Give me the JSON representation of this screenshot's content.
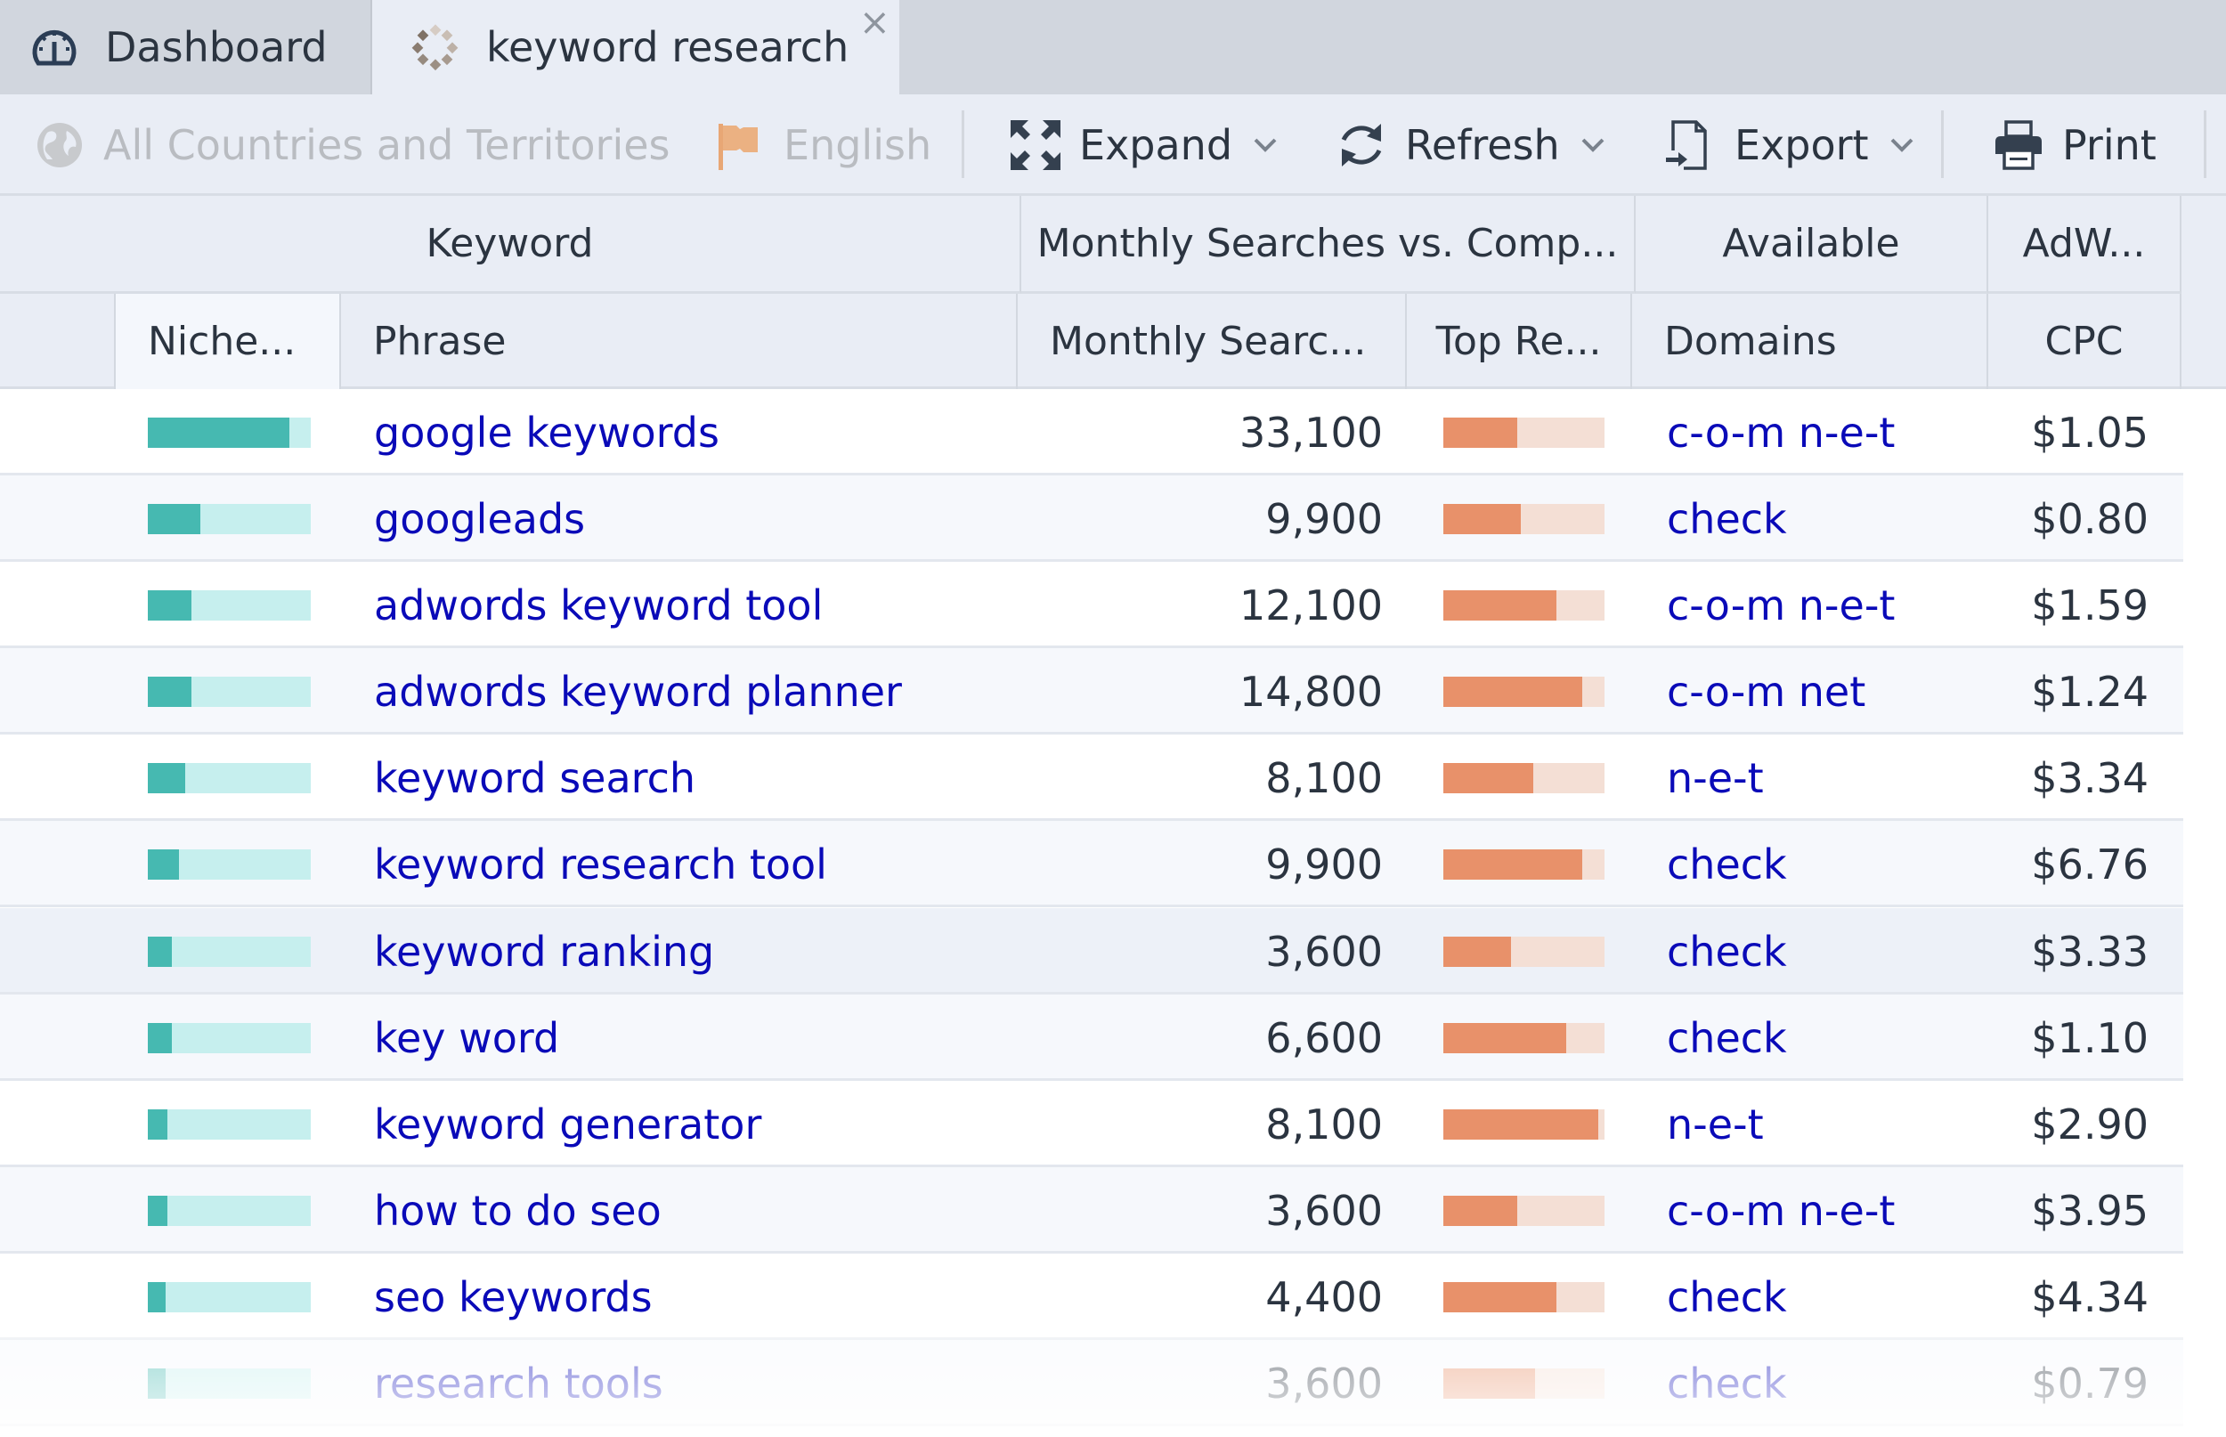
{
  "tabs": [
    {
      "label": "Dashboard",
      "icon": "dashboard-gauge-icon",
      "active": false
    },
    {
      "label": "keyword research",
      "icon": "loading-spinner-icon",
      "active": true,
      "closable": true,
      "close_glyph": "×"
    }
  ],
  "toolbar": {
    "location": {
      "label": "All Countries and Territories",
      "icon": "globe-icon",
      "disabled": true
    },
    "language": {
      "label": "English",
      "icon": "flag-icon",
      "disabled": true
    },
    "expand": {
      "label": "Expand",
      "icon": "expand-arrows-icon",
      "has_dropdown": true
    },
    "refresh": {
      "label": "Refresh",
      "icon": "refresh-icon",
      "has_dropdown": true
    },
    "export": {
      "label": "Export",
      "icon": "export-file-icon",
      "has_dropdown": true
    },
    "print": {
      "label": "Print",
      "icon": "printer-icon"
    }
  },
  "header": {
    "groups": [
      "Keyword",
      "Monthly Searches vs. Comp...",
      "Available",
      "AdW..."
    ],
    "columns": [
      "Niche...",
      "Phrase",
      "Monthly Searc...",
      "Top Re...",
      "Domains",
      "CPC"
    ]
  },
  "colors": {
    "niche_fill": "#46b9b1",
    "niche_track": "#c6efee",
    "topre_fill": "#e8916a",
    "topre_track": "#f4dfd5",
    "link": "#0a0ab8"
  },
  "rows": [
    {
      "niche": 0.87,
      "phrase": "google keywords",
      "searches": "33,100",
      "top_re": 0.46,
      "domains": "c-o-m n-e-t",
      "cpc": "$1.05"
    },
    {
      "niche": 0.32,
      "phrase": "googleads",
      "searches": "9,900",
      "top_re": 0.48,
      "domains": "check",
      "cpc": "$0.80"
    },
    {
      "niche": 0.27,
      "phrase": "adwords keyword tool",
      "searches": "12,100",
      "top_re": 0.7,
      "domains": "c-o-m n-e-t",
      "cpc": "$1.59"
    },
    {
      "niche": 0.27,
      "phrase": "adwords keyword planner",
      "searches": "14,800",
      "top_re": 0.86,
      "domains": "c-o-m net",
      "cpc": "$1.24"
    },
    {
      "niche": 0.23,
      "phrase": "keyword search",
      "searches": "8,100",
      "top_re": 0.56,
      "domains": "n-e-t",
      "cpc": "$3.34"
    },
    {
      "niche": 0.19,
      "phrase": "keyword research tool",
      "searches": "9,900",
      "top_re": 0.86,
      "domains": "check",
      "cpc": "$6.76"
    },
    {
      "niche": 0.15,
      "phrase": "keyword ranking",
      "searches": "3,600",
      "top_re": 0.42,
      "domains": "check",
      "cpc": "$3.33",
      "hover": true
    },
    {
      "niche": 0.15,
      "phrase": "key word",
      "searches": "6,600",
      "top_re": 0.76,
      "domains": "check",
      "cpc": "$1.10"
    },
    {
      "niche": 0.12,
      "phrase": "keyword generator",
      "searches": "8,100",
      "top_re": 0.96,
      "domains": "n-e-t",
      "cpc": "$2.90"
    },
    {
      "niche": 0.12,
      "phrase": "how to do seo",
      "searches": "3,600",
      "top_re": 0.46,
      "domains": "c-o-m n-e-t",
      "cpc": "$3.95"
    },
    {
      "niche": 0.11,
      "phrase": "seo keywords",
      "searches": "4,400",
      "top_re": 0.7,
      "domains": "check",
      "cpc": "$4.34"
    },
    {
      "niche": 0.11,
      "phrase": "research tools",
      "searches": "3,600",
      "top_re": 0.57,
      "domains": "check",
      "cpc": "$0.79"
    }
  ]
}
